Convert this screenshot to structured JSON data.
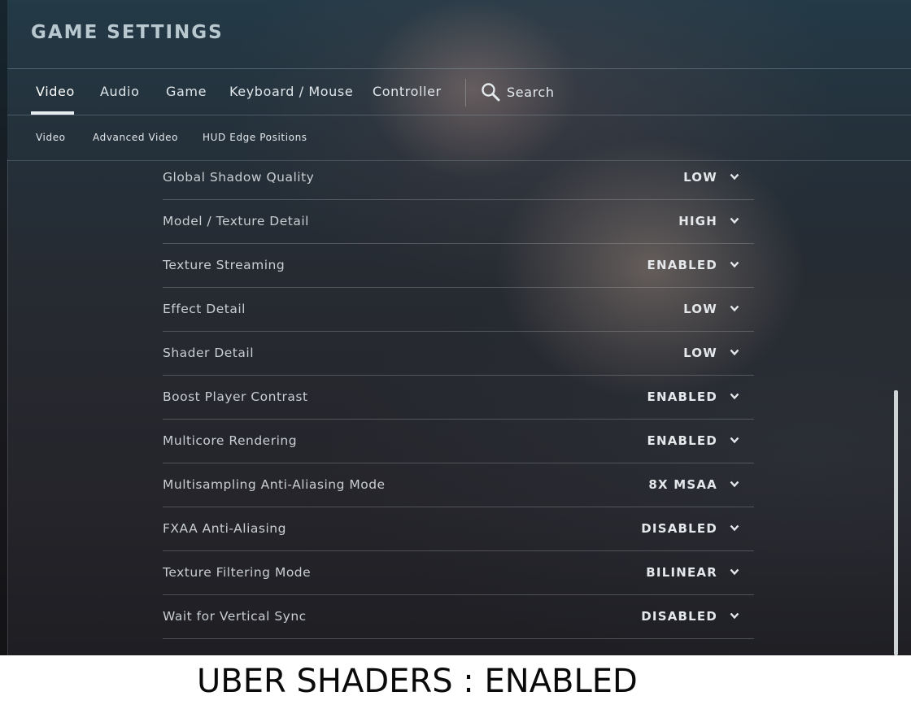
{
  "header": {
    "title": "GAME SETTINGS"
  },
  "tabs": [
    {
      "label": "Video",
      "active": true
    },
    {
      "label": "Audio"
    },
    {
      "label": "Game"
    },
    {
      "label": "Keyboard / Mouse"
    },
    {
      "label": "Controller"
    }
  ],
  "search": {
    "label": "Search",
    "icon": "search-icon"
  },
  "subtabs": [
    {
      "label": "Video"
    },
    {
      "label": "Advanced Video"
    },
    {
      "label": "HUD Edge Positions"
    }
  ],
  "settings": [
    {
      "label": "Global Shadow Quality",
      "value": "LOW"
    },
    {
      "label": "Model / Texture Detail",
      "value": "HIGH"
    },
    {
      "label": "Texture Streaming",
      "value": "ENABLED"
    },
    {
      "label": "Effect Detail",
      "value": "LOW"
    },
    {
      "label": "Shader Detail",
      "value": "LOW"
    },
    {
      "label": "Boost Player Contrast",
      "value": "ENABLED"
    },
    {
      "label": "Multicore Rendering",
      "value": "ENABLED"
    },
    {
      "label": "Multisampling Anti-Aliasing Mode",
      "value": "8X MSAA"
    },
    {
      "label": "FXAA Anti-Aliasing",
      "value": "DISABLED"
    },
    {
      "label": "Texture Filtering Mode",
      "value": "BILINEAR"
    },
    {
      "label": "Wait for Vertical Sync",
      "value": "DISABLED"
    }
  ],
  "caption": "UBER SHADERS : ENABLED",
  "colors": {
    "accent": "#e6ecef",
    "text": "#c9ced2",
    "background": "#25292f"
  }
}
